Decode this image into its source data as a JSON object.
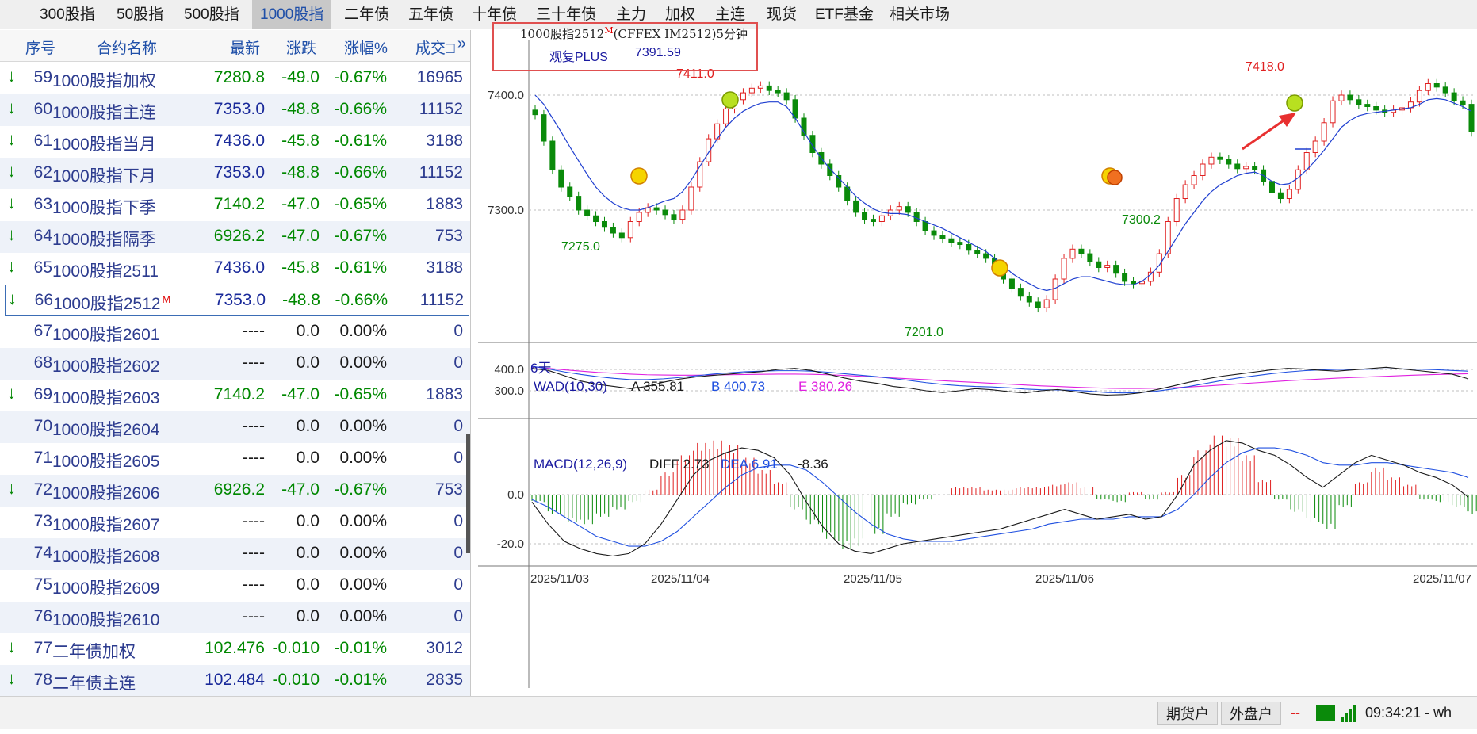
{
  "tabs": [
    "300股指",
    "50股指",
    "500股指",
    "1000股指",
    "二年债",
    "五年债",
    "十年债",
    "三十年债",
    "主力",
    "加权",
    "主连",
    "现货",
    "ETF基金",
    "相关市场"
  ],
  "active_tab": "1000股指",
  "table": {
    "columns": [
      "序号",
      "合约名称",
      "最新",
      "涨跌",
      "涨幅%",
      "成交□"
    ],
    "rows": [
      {
        "arrow": "↓",
        "idx": "59",
        "name": "1000股指加权",
        "last": "7280.8",
        "chg": "-49.0",
        "pct": "-0.67%",
        "vol": "16965"
      },
      {
        "arrow": "↓",
        "idx": "60",
        "name": "1000股指主连",
        "last": "7353.0",
        "chg": "-48.8",
        "pct": "-0.66%",
        "vol": "11152"
      },
      {
        "arrow": "↓",
        "idx": "61",
        "name": "1000股指当月",
        "last": "7436.0",
        "chg": "-45.8",
        "pct": "-0.61%",
        "vol": "3188"
      },
      {
        "arrow": "↓",
        "idx": "62",
        "name": "1000股指下月",
        "last": "7353.0",
        "chg": "-48.8",
        "pct": "-0.66%",
        "vol": "11152"
      },
      {
        "arrow": "↓",
        "idx": "63",
        "name": "1000股指下季",
        "last": "7140.2",
        "chg": "-47.0",
        "pct": "-0.65%",
        "vol": "1883"
      },
      {
        "arrow": "↓",
        "idx": "64",
        "name": "1000股指隔季",
        "last": "6926.2",
        "chg": "-47.0",
        "pct": "-0.67%",
        "vol": "753"
      },
      {
        "arrow": "↓",
        "idx": "65",
        "name": "1000股指2511",
        "last": "7436.0",
        "chg": "-45.8",
        "pct": "-0.61%",
        "vol": "3188"
      },
      {
        "arrow": "↓",
        "idx": "66",
        "name": "1000股指2512",
        "mark": "M",
        "last": "7353.0",
        "chg": "-48.8",
        "pct": "-0.66%",
        "vol": "11152",
        "selected": true
      },
      {
        "arrow": "",
        "idx": "67",
        "name": "1000股指2601",
        "last": "----",
        "chg": "0.0",
        "pct": "0.00%",
        "vol": "0"
      },
      {
        "arrow": "",
        "idx": "68",
        "name": "1000股指2602",
        "last": "----",
        "chg": "0.0",
        "pct": "0.00%",
        "vol": "0"
      },
      {
        "arrow": "↓",
        "idx": "69",
        "name": "1000股指2603",
        "last": "7140.2",
        "chg": "-47.0",
        "pct": "-0.65%",
        "vol": "1883"
      },
      {
        "arrow": "",
        "idx": "70",
        "name": "1000股指2604",
        "last": "----",
        "chg": "0.0",
        "pct": "0.00%",
        "vol": "0"
      },
      {
        "arrow": "",
        "idx": "71",
        "name": "1000股指2605",
        "last": "----",
        "chg": "0.0",
        "pct": "0.00%",
        "vol": "0"
      },
      {
        "arrow": "↓",
        "idx": "72",
        "name": "1000股指2606",
        "last": "6926.2",
        "chg": "-47.0",
        "pct": "-0.67%",
        "vol": "753"
      },
      {
        "arrow": "",
        "idx": "73",
        "name": "1000股指2607",
        "last": "----",
        "chg": "0.0",
        "pct": "0.00%",
        "vol": "0"
      },
      {
        "arrow": "",
        "idx": "74",
        "name": "1000股指2608",
        "last": "----",
        "chg": "0.0",
        "pct": "0.00%",
        "vol": "0"
      },
      {
        "arrow": "",
        "idx": "75",
        "name": "1000股指2609",
        "last": "----",
        "chg": "0.0",
        "pct": "0.00%",
        "vol": "0"
      },
      {
        "arrow": "",
        "idx": "76",
        "name": "1000股指2610",
        "last": "----",
        "chg": "0.0",
        "pct": "0.00%",
        "vol": "0"
      },
      {
        "arrow": "↓",
        "idx": "77",
        "name": "二年债加权",
        "last": "102.476",
        "chg": "-0.010",
        "pct": "-0.01%",
        "vol": "3012"
      },
      {
        "arrow": "↓",
        "idx": "78",
        "name": "二年债主连",
        "last": "102.484",
        "chg": "-0.010",
        "pct": "-0.01%",
        "vol": "2835"
      }
    ]
  },
  "chart": {
    "title_main": "1000股指2512",
    "title_mark": "M",
    "title_rest": "(CFFEX IM2512)5分钟",
    "indicator_label": "观复PLUS",
    "indicator_value": "7391.59",
    "days_label": "6天",
    "wad_label": "WAD(10,30)",
    "wad_a": "A 355.81",
    "wad_b": "B 400.73",
    "wad_e": "E 380.26",
    "macd_label": "MACD(12,26,9)",
    "macd_diff": "DIFF 2.73",
    "macd_dea": "DEA 6.91",
    "macd_val": "-8.36",
    "colors": {
      "up": "#e02020",
      "down": "#0a8a0a",
      "ma": "#1f3fd0",
      "wad_e": "#e020e0",
      "wad_b": "#2050e0",
      "grid": "#bfbfbf"
    }
  },
  "chart_data": {
    "type": "line",
    "price": {
      "y_ticks": [
        "7400.0",
        "7300.0"
      ],
      "annotations": [
        {
          "text": "7411.0",
          "color": "up"
        },
        {
          "text": "7275.0",
          "color": "down"
        },
        {
          "text": "7201.0",
          "color": "down"
        },
        {
          "text": "7300.2",
          "color": "down"
        },
        {
          "text": "7418.0",
          "color": "up"
        }
      ],
      "close_series": [
        7383,
        7360,
        7335,
        7320,
        7312,
        7300,
        7295,
        7290,
        7285,
        7280,
        7276,
        7290,
        7298,
        7302,
        7300,
        7296,
        7292,
        7300,
        7320,
        7342,
        7362,
        7375,
        7388,
        7396,
        7402,
        7406,
        7408,
        7404,
        7402,
        7396,
        7380,
        7365,
        7350,
        7340,
        7330,
        7320,
        7308,
        7298,
        7292,
        7290,
        7295,
        7300,
        7303,
        7298,
        7290,
        7282,
        7278,
        7275,
        7272,
        7270,
        7265,
        7262,
        7258,
        7250,
        7240,
        7232,
        7225,
        7220,
        7215,
        7222,
        7240,
        7258,
        7266,
        7262,
        7255,
        7250,
        7252,
        7245,
        7238,
        7236,
        7238,
        7246,
        7262,
        7290,
        7310,
        7322,
        7330,
        7340,
        7346,
        7344,
        7340,
        7336,
        7338,
        7335,
        7325,
        7315,
        7310,
        7318,
        7335,
        7350,
        7360,
        7376,
        7395,
        7400,
        7396,
        7392,
        7390,
        7387,
        7385,
        7387,
        7389,
        7394,
        7404,
        7410,
        7407,
        7402,
        7395,
        7392,
        7368
      ],
      "ma_series": [
        7400,
        7392,
        7380,
        7368,
        7355,
        7343,
        7331,
        7320,
        7312,
        7306,
        7302,
        7300,
        7300,
        7302,
        7305,
        7308,
        7310,
        7316,
        7326,
        7338,
        7350,
        7362,
        7372,
        7380,
        7386,
        7390,
        7393,
        7394,
        7394,
        7390,
        7380,
        7368,
        7356,
        7345,
        7336,
        7328,
        7320,
        7312,
        7306,
        7301,
        7298,
        7297,
        7297,
        7296,
        7293,
        7290,
        7287,
        7284,
        7280,
        7276,
        7272,
        7268,
        7264,
        7258,
        7252,
        7245,
        7240,
        7236,
        7232,
        7230,
        7232,
        7236,
        7240,
        7242,
        7242,
        7240,
        7238,
        7236,
        7235,
        7235,
        7238,
        7244,
        7252,
        7264,
        7276,
        7288,
        7298,
        7308,
        7316,
        7322,
        7326,
        7330,
        7332,
        7333,
        7330,
        7325,
        7322,
        7323,
        7328,
        7335,
        7343,
        7352,
        7362,
        7372,
        7378,
        7382,
        7384,
        7385,
        7386,
        7387,
        7388,
        7389,
        7392,
        7396,
        7397,
        7396,
        7393,
        7390,
        7386
      ]
    },
    "x_ticks": [
      "2025/11/03",
      "2025/11/04",
      "2025/11/05",
      "2025/11/06",
      "2025/11/07"
    ],
    "wad": {
      "y_ticks": [
        "400.0",
        "300.0"
      ],
      "a": [
        405,
        395,
        370,
        345,
        330,
        320,
        310,
        320,
        340,
        355,
        365,
        372,
        378,
        384,
        390,
        400,
        405,
        395,
        378,
        360,
        345,
        335,
        320,
        312,
        300,
        292,
        300,
        310,
        305,
        296,
        290,
        300,
        306,
        296,
        285,
        280,
        282,
        290,
        305,
        322,
        340,
        355,
        368,
        378,
        388,
        398,
        405,
        402,
        396,
        392,
        398,
        404,
        410,
        402,
        394,
        386,
        378,
        356
      ],
      "b": [
        415,
        402,
        388,
        376,
        366,
        358,
        352,
        352,
        356,
        362,
        370,
        378,
        384,
        389,
        392,
        394,
        394,
        392,
        387,
        380,
        373,
        366,
        357,
        348,
        338,
        330,
        324,
        320,
        318,
        314,
        308,
        305,
        304,
        302,
        298,
        292,
        290,
        292,
        298,
        308,
        320,
        334,
        348,
        360,
        370,
        380,
        388,
        394,
        398,
        400,
        400,
        401,
        402,
        402,
        401,
        399,
        395,
        392
      ],
      "e": [
        412,
        405,
        398,
        392,
        386,
        382,
        378,
        375,
        374,
        373,
        373,
        374,
        375,
        376,
        377,
        378,
        378,
        377,
        375,
        372,
        368,
        364,
        360,
        356,
        352,
        347,
        343,
        339,
        335,
        331,
        327,
        323,
        320,
        317,
        314,
        312,
        311,
        311,
        312,
        314,
        318,
        322,
        327,
        332,
        337,
        342,
        347,
        351,
        355,
        359,
        362,
        365,
        368,
        371,
        374,
        376,
        378,
        380
      ]
    },
    "macd": {
      "y_ticks": [
        "0.0",
        "-20.0"
      ],
      "diff": [
        -3,
        -12,
        -19,
        -22,
        -24,
        -25,
        -24,
        -20,
        -12,
        -2,
        8,
        14,
        17,
        19,
        18,
        15,
        8,
        -3,
        -13,
        -20,
        -23,
        -24,
        -22,
        -20,
        -19,
        -18,
        -17,
        -16,
        -15,
        -14,
        -12,
        -10,
        -8,
        -6,
        -8,
        -10,
        -9,
        -8,
        -10,
        -9,
        0,
        12,
        18,
        22,
        21,
        18,
        16,
        12,
        7,
        3,
        8,
        13,
        16,
        14,
        12,
        9,
        7,
        4,
        -1
      ],
      "dea": [
        -2,
        -5,
        -9,
        -13,
        -17,
        -19,
        -21,
        -21,
        -19,
        -15,
        -9,
        -3,
        3,
        8,
        11,
        12,
        12,
        10,
        5,
        -1,
        -7,
        -12,
        -16,
        -18,
        -19,
        -19,
        -19,
        -18,
        -17,
        -16,
        -15,
        -14,
        -12,
        -11,
        -10,
        -10,
        -10,
        -9,
        -9,
        -9,
        -6,
        0,
        7,
        13,
        17,
        19,
        19,
        18,
        16,
        13,
        12,
        12,
        13,
        13,
        12,
        11,
        10,
        9,
        7
      ],
      "hist": [
        -3,
        -8,
        -11,
        -12,
        -9,
        -6,
        -3,
        2,
        9,
        16,
        21,
        22,
        20,
        15,
        10,
        5,
        -6,
        -12,
        -18,
        -22,
        -21,
        -16,
        -9,
        -4,
        -2,
        0,
        3,
        3,
        2,
        2,
        3,
        3,
        4,
        5,
        3,
        -2,
        -3,
        1,
        -2,
        1,
        8,
        18,
        24,
        23,
        16,
        6,
        -2,
        -7,
        -11,
        -14,
        -5,
        5,
        11,
        7,
        4,
        -2,
        -3,
        -5,
        -8
      ]
    }
  },
  "status": {
    "btn_futures": "期货户",
    "btn_outer": "外盘户",
    "time": "09:34:21 - wh"
  }
}
